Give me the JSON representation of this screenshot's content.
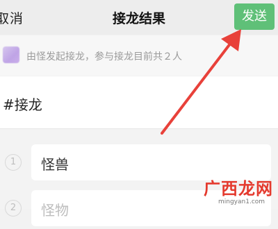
{
  "header": {
    "cancel_label": "取消",
    "title": "接龙结果",
    "send_label": "发送",
    "send_color": "#5fc078"
  },
  "info": {
    "text": "由怪发起接龙，参与接龙目前共２人"
  },
  "topic": {
    "text": "#接龙"
  },
  "entries": [
    {
      "index": "1",
      "text": "怪兽"
    },
    {
      "index": "2",
      "text": "怪物"
    }
  ],
  "annotation": {
    "arrow_color": "#e8413a"
  },
  "watermark": {
    "brand": "广西龙网",
    "url": "mingyan1.com"
  }
}
